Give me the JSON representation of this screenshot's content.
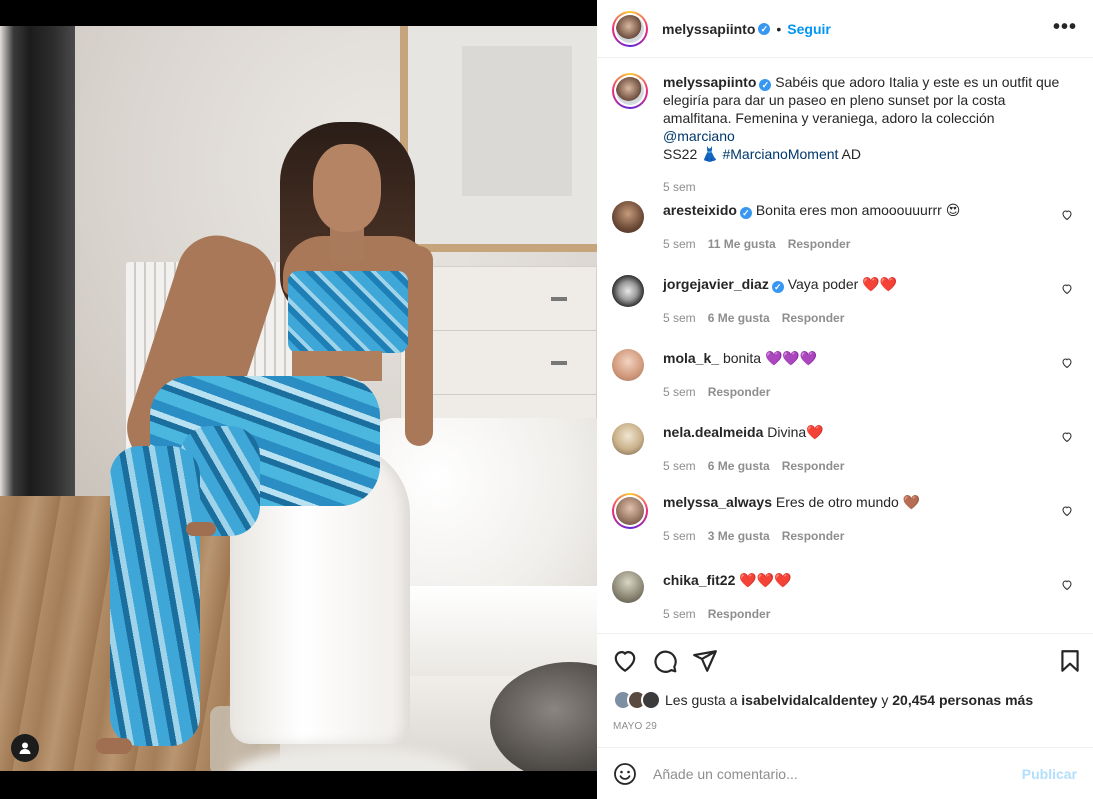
{
  "post": {
    "author": "melyssapiinto",
    "follow_label": "Seguir",
    "more_glyph": "•••",
    "tag_icon": "user-tag-icon"
  },
  "caption": {
    "author": "melyssapiinto",
    "text_before_mention": "Sabéis que adoro Italia y este es un outfit que elegiría para dar un paseo en pleno sunset por la costa amalfitana. Femenina y veraniega, adoro la colección",
    "mention": "@marciano",
    "text_after_mention": "SS22",
    "emoji": "👗",
    "hashtag": "#MarcianoMoment",
    "suffix": "AD",
    "time": "5 sem"
  },
  "comments": [
    {
      "user": "aresteixido",
      "verified": true,
      "text": "Bonita eres mon amooouuurrr",
      "emoji": "😍",
      "time": "5 sem",
      "likes": "11 Me gusta",
      "reply": "Responder",
      "avatar_color": "#8a6a52"
    },
    {
      "user": "jorgejavier_diaz",
      "verified": true,
      "text": "Vaya poder",
      "emoji": "❤️❤️",
      "time": "5 sem",
      "likes": "6 Me gusta",
      "reply": "Responder",
      "avatar_color": "#2b2b2b"
    },
    {
      "user": "mola_k_",
      "verified": false,
      "text": "bonita",
      "emoji": "💜💜💜",
      "time": "5 sem",
      "likes": "",
      "reply": "Responder",
      "avatar_color": "#d7a58a"
    },
    {
      "user": "nela.dealmeida",
      "verified": false,
      "text": "Divina",
      "emoji": "❤️",
      "time": "5 sem",
      "likes": "6 Me gusta",
      "reply": "Responder",
      "avatar_color": "#c9b79a"
    },
    {
      "user": "melyssa_always",
      "verified": false,
      "text": "Eres de otro mundo",
      "emoji": "🤎",
      "time": "5 sem",
      "likes": "3 Me gusta",
      "reply": "Responder",
      "avatar_color": "#9c7a66",
      "story_ring": true
    },
    {
      "user": "chika_fit22",
      "verified": false,
      "text": "",
      "emoji": "❤️❤️❤️",
      "time": "5 sem",
      "likes": "",
      "reply": "Responder",
      "avatar_color": "#7d7a6a"
    }
  ],
  "actions": {
    "like_icon": "heart-icon",
    "comment_icon": "comment-icon",
    "share_icon": "share-icon",
    "save_icon": "bookmark-icon"
  },
  "likes": {
    "prefix": "Les gusta a",
    "user": "isabelvidalcaldentey",
    "middle": "y",
    "count": "20,454 personas más"
  },
  "date": "MAYO 29",
  "add_comment": {
    "placeholder": "Añade un comentario...",
    "publish_label": "Publicar",
    "emoji_icon": "smiley-icon"
  },
  "colors": {
    "accent": "#0095f6",
    "link": "#00376b",
    "muted": "#8e8e8e",
    "publish_disabled": "#b2dffc"
  }
}
